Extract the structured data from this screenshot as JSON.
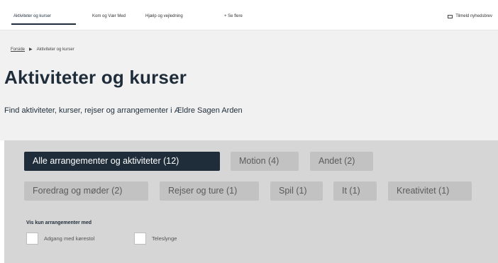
{
  "topnav": {
    "items": [
      {
        "label": "Aktiviteter og kurser"
      },
      {
        "label": "Kom og Vær Med"
      },
      {
        "label": "Hjælp og vejledning"
      },
      {
        "label": "+ Se flere"
      }
    ],
    "newsletter_label": "Tilmeld nyhedsbrev",
    "newsletter_icon": "mail-icon"
  },
  "breadcrumb": {
    "home": "Forside",
    "separator": "▶",
    "current": "Aktiviteter og kurser"
  },
  "hero": {
    "title": "Aktiviteter og kurser",
    "subtitle": "Find aktiviteter, kurser, rejser og arrangementer i Ældre Sagen Arden"
  },
  "filters": {
    "chips": [
      {
        "label": "Alle arrangementer og aktiviteter (12)",
        "active": true
      },
      {
        "label": "Motion (4)"
      },
      {
        "label": "Andet (2)"
      },
      {
        "label": "Foredrag og møder (2)"
      },
      {
        "label": "Rejser og ture (1)"
      },
      {
        "label": "Spil (1)"
      },
      {
        "label": "It (1)"
      },
      {
        "label": "Kreativitet (1)"
      }
    ],
    "show_only_label": "Vis kun arrangementer med",
    "checkboxes": [
      {
        "label": "Adgang med kørestol",
        "checked": false
      },
      {
        "label": "Teleslynge",
        "checked": false
      }
    ]
  },
  "colors": {
    "primary": "#1f2d3a",
    "hero_bg": "#f1f1f1",
    "filter_bg": "#d6d6d6",
    "chip_bg": "#c2c2c2"
  }
}
